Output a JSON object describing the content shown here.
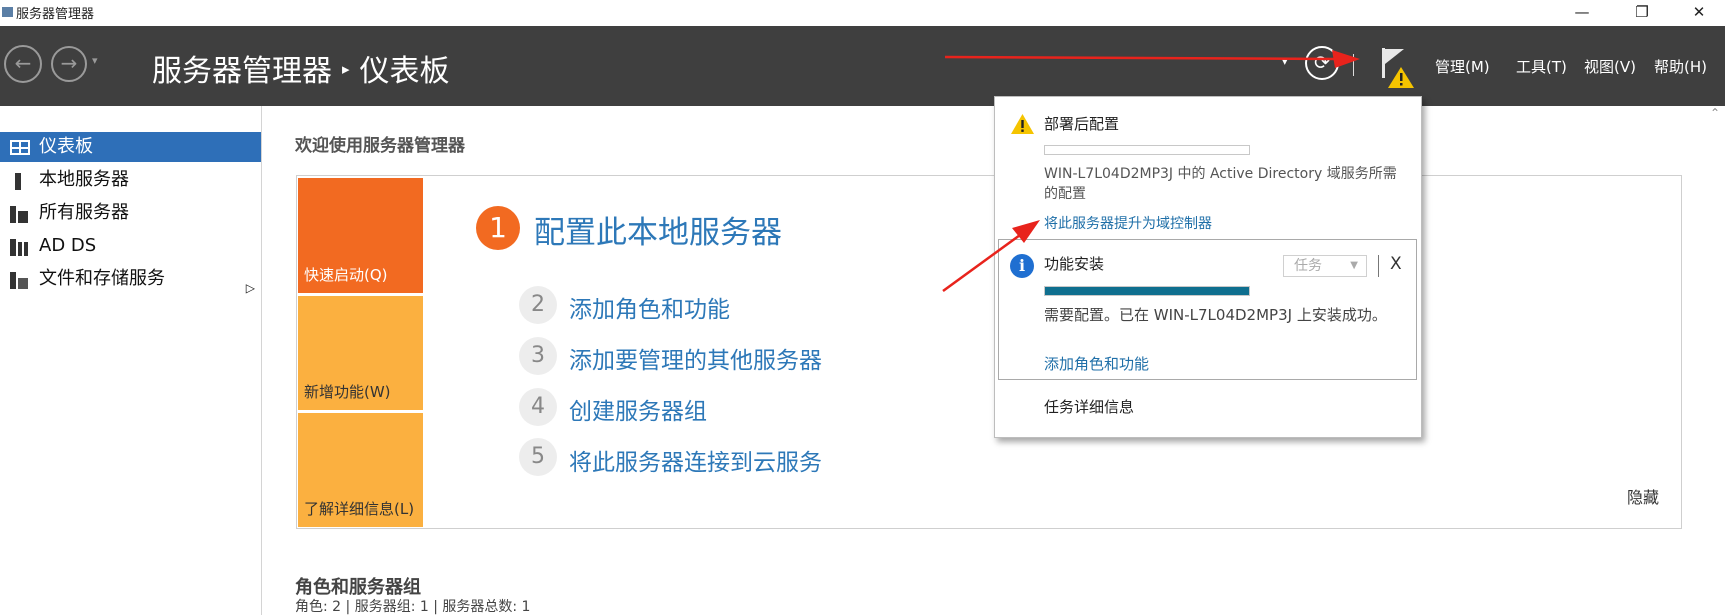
{
  "window": {
    "title": "服务器管理器",
    "minimize": "—",
    "restore": "❐",
    "close": "✕"
  },
  "header": {
    "breadcrumb_app": "服务器管理器",
    "breadcrumb_sep": "▸",
    "breadcrumb_page": "仪表板",
    "back_glyph": "←",
    "forward_glyph": "→",
    "dropdown_glyph": "▾",
    "refresh_glyph": "⟳",
    "menus": [
      "管理(M)",
      "工具(T)",
      "视图(V)",
      "帮助(H)"
    ]
  },
  "sidebar": {
    "items": [
      {
        "label": "仪表板",
        "icon": "dashboard-icon",
        "active": true
      },
      {
        "label": "本地服务器",
        "icon": "server-icon"
      },
      {
        "label": "所有服务器",
        "icon": "servers-icon"
      },
      {
        "label": "AD DS",
        "icon": "ad-ds-icon"
      },
      {
        "label": "文件和存储服务",
        "icon": "storage-icon",
        "expand": "▷"
      }
    ]
  },
  "main": {
    "welcome": "欢迎使用服务器管理器",
    "tiles": [
      "快速启动(Q)",
      "新增功能(W)",
      "了解详细信息(L)"
    ],
    "steps": [
      {
        "num": "1",
        "label": "配置此本地服务器"
      },
      {
        "num": "2",
        "label": "添加角色和功能"
      },
      {
        "num": "3",
        "label": "添加要管理的其他服务器"
      },
      {
        "num": "4",
        "label": "创建服务器组"
      },
      {
        "num": "5",
        "label": "将此服务器连接到云服务"
      }
    ],
    "hide": "隐藏",
    "roles_title": "角色和服务器组",
    "roles_stats": "角色: 2 | 服务器组: 1 | 服务器总数: 1"
  },
  "notifications": {
    "item1": {
      "title": "部署后配置",
      "description": "WIN-L7L04D2MP3J 中的 Active Directory 域服务所需的配置",
      "link": "将此服务器提升为域控制器"
    },
    "item2": {
      "title": "功能安装",
      "task_label": "任务",
      "close": "X",
      "progress": 1.0,
      "description": "需要配置。已在 WIN-L7L04D2MP3J 上安装成功。",
      "link": "添加角色和功能"
    },
    "task_details": "任务详细信息"
  },
  "colors": {
    "header_bg": "#3f3f3f",
    "active_nav": "#2e6fb8",
    "tile_orange": "#f26a21",
    "tile_amber": "#fbb040",
    "link_blue": "#2d78b8",
    "annotation_red": "#e8231c"
  }
}
